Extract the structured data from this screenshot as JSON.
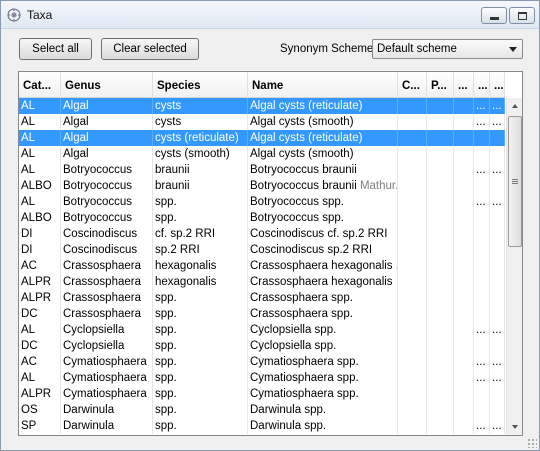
{
  "window": {
    "title": "Taxa"
  },
  "toolbar": {
    "select_all_label": "Select all",
    "clear_selected_label": "Clear selected",
    "synonym_label": "Synonym Scheme:",
    "synonym_value": "Default scheme"
  },
  "columns": [
    "Cat...",
    "Genus",
    "Species",
    "Name",
    "C...",
    "P...",
    "...",
    "...",
    "..."
  ],
  "rows": [
    {
      "cells": [
        "AL",
        "Algal",
        "cysts",
        "Algal cysts (reticulate)",
        "",
        "",
        "",
        "...",
        "..."
      ],
      "extra": "",
      "selected": true
    },
    {
      "cells": [
        "AL",
        "Algal",
        "cysts",
        "Algal cysts (smooth)",
        "",
        "",
        "",
        "...",
        "..."
      ],
      "extra": "",
      "selected": false
    },
    {
      "cells": [
        "AL",
        "Algal",
        "cysts (reticulate)",
        "Algal cysts (reticulate)",
        "",
        "",
        "",
        "",
        ""
      ],
      "extra": "",
      "selected": true
    },
    {
      "cells": [
        "AL",
        "Algal",
        "cysts (smooth)",
        "Algal cysts (smooth)",
        "",
        "",
        "",
        "",
        ""
      ],
      "extra": "",
      "selected": false
    },
    {
      "cells": [
        "AL",
        "Botryococcus",
        "braunii",
        "Botryococcus braunii",
        "",
        "",
        "",
        "...",
        "..."
      ],
      "extra": "",
      "selected": false
    },
    {
      "cells": [
        "ALBO",
        "Botryococcus",
        "braunii",
        "Botryococcus braunii",
        "",
        "",
        "",
        "",
        ""
      ],
      "extra": " Mathur...",
      "selected": false
    },
    {
      "cells": [
        "AL",
        "Botryococcus",
        "spp.",
        "Botryococcus spp.",
        "",
        "",
        "",
        "...",
        "..."
      ],
      "extra": "",
      "selected": false
    },
    {
      "cells": [
        "ALBO",
        "Botryococcus",
        "spp.",
        "Botryococcus spp.",
        "",
        "",
        "",
        "",
        ""
      ],
      "extra": "",
      "selected": false
    },
    {
      "cells": [
        "DI",
        "Coscinodiscus",
        "cf. sp.2 RRI",
        "Coscinodiscus cf. sp.2 RRI",
        "",
        "",
        "",
        "",
        ""
      ],
      "extra": "",
      "selected": false
    },
    {
      "cells": [
        "DI",
        "Coscinodiscus",
        "sp.2 RRI",
        "Coscinodiscus sp.2 RRI",
        "",
        "",
        "",
        "",
        ""
      ],
      "extra": "",
      "selected": false
    },
    {
      "cells": [
        "AC",
        "Crassosphaera",
        "hexagonalis",
        "Crassosphaera hexagonalis ...",
        "",
        "",
        "",
        "",
        ""
      ],
      "extra": "",
      "selected": false
    },
    {
      "cells": [
        "ALPR",
        "Crassosphaera",
        "hexagonalis",
        "Crassosphaera hexagonalis",
        "",
        "",
        "",
        "",
        ""
      ],
      "extra": "",
      "selected": false
    },
    {
      "cells": [
        "ALPR",
        "Crassosphaera",
        "spp.",
        "Crassosphaera spp.",
        "",
        "",
        "",
        "",
        ""
      ],
      "extra": "",
      "selected": false
    },
    {
      "cells": [
        "DC",
        "Crassosphaera",
        "spp.",
        "Crassosphaera spp.",
        "",
        "",
        "",
        "",
        ""
      ],
      "extra": "",
      "selected": false
    },
    {
      "cells": [
        "AL",
        "Cyclopsiella",
        "spp.",
        "Cyclopsiella spp.",
        "",
        "",
        "",
        "...",
        "..."
      ],
      "extra": "",
      "selected": false
    },
    {
      "cells": [
        "DC",
        "Cyclopsiella",
        "spp.",
        "Cyclopsiella spp.",
        "",
        "",
        "",
        "",
        ""
      ],
      "extra": "",
      "selected": false
    },
    {
      "cells": [
        "AC",
        "Cymatiosphaera",
        "spp.",
        "Cymatiosphaera spp.",
        "",
        "",
        "",
        "...",
        "..."
      ],
      "extra": "",
      "selected": false
    },
    {
      "cells": [
        "AL",
        "Cymatiosphaera",
        "spp.",
        "Cymatiosphaera spp.",
        "",
        "",
        "",
        "...",
        "..."
      ],
      "extra": "",
      "selected": false
    },
    {
      "cells": [
        "ALPR",
        "Cymatiosphaera",
        "spp.",
        "Cymatiosphaera spp.",
        "",
        "",
        "",
        "",
        ""
      ],
      "extra": "",
      "selected": false
    },
    {
      "cells": [
        "OS",
        "Darwinula",
        "spp.",
        "Darwinula spp.",
        "",
        "",
        "",
        "",
        ""
      ],
      "extra": "",
      "selected": false
    },
    {
      "cells": [
        "SP",
        "Darwinula",
        "spp.",
        "Darwinula spp.",
        "",
        "",
        "",
        "...",
        "..."
      ],
      "extra": "",
      "selected": false
    }
  ]
}
